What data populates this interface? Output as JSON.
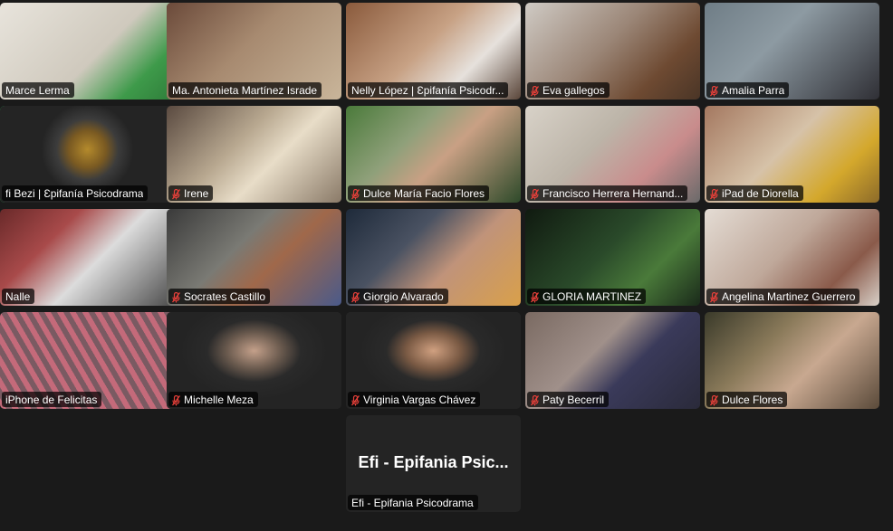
{
  "participants": [
    {
      "name": "Marce Lerma",
      "muted": false,
      "bg": "linear-gradient(135deg,#e8e4dc 0%,#cfc9bd 55%,#3e9a4a 80%,#2f7d3a 100%)"
    },
    {
      "name": "Ma. Antonieta Martínez Israde",
      "muted": false,
      "bg": "linear-gradient(135deg,#6b4a3a 0%,#a78a70 45%,#c9b59a 100%)"
    },
    {
      "name": "Nelly López | Ɛpifanía Psicodr...",
      "muted": false,
      "bg": "linear-gradient(135deg,#8a5a3c 0%,#c7a184 45%,#e6e1dc 70%,#5a463a 100%)"
    },
    {
      "name": "Eva gallegos",
      "muted": true,
      "bg": "linear-gradient(135deg,#cfcac4 0%,#9b8677 45%,#6e4a32 75%,#4a3526 100%)"
    },
    {
      "name": "Amalia Parra",
      "muted": true,
      "bg": "linear-gradient(135deg,#6f7d86 0%,#8d9aa2 40%,#2f2f35 100%)"
    },
    {
      "name": "fi Bezi | Ɛpifanía Psicodrama",
      "muted": false,
      "bg": "radial-gradient(circle at 50% 45%,#b48a2c 0%,#7a5a22 18%,#3c3c3c 30%,#242424 45%)"
    },
    {
      "name": "Irene",
      "muted": true,
      "bg": "linear-gradient(135deg,#5a4a40 0%,#b8a890 40%,#e8ddc8 60%,#8a7a68 100%)"
    },
    {
      "name": "Dulce María Facio Flores",
      "muted": true,
      "bg": "linear-gradient(135deg,#4a7a3a 0%,#8fa07a 35%,#c9a084 55%,#2e4a2a 100%)"
    },
    {
      "name": "Francisco Herrera Hernand...",
      "muted": true,
      "bg": "linear-gradient(135deg,#d8d2c8 0%,#bcb4a8 40%,#c98c8c 70%,#6a6a6a 100%)"
    },
    {
      "name": "iPad de Diorella",
      "muted": true,
      "bg": "linear-gradient(135deg,#a47860 0%,#d6c2a8 45%,#d4a82c 75%,#8c6a2a 100%)"
    },
    {
      "name": "Nalle",
      "muted": false,
      "bg": "linear-gradient(135deg,#6a2a2a 0%,#a84a4a 30%,#dcdcdc 55%,#4a4a4a 100%)"
    },
    {
      "name": "Socrates Castillo",
      "muted": true,
      "bg": "linear-gradient(135deg,#3a3a3a 0%,#7a7a74 40%,#a0684a 60%,#4a5a8a 100%)"
    },
    {
      "name": "Giorgio Alvarado",
      "muted": true,
      "bg": "linear-gradient(135deg,#1e2a3a 0%,#4a5262 35%,#c0937a 60%,#d9a04a 100%)"
    },
    {
      "name": "GLORIA MARTINEZ",
      "muted": true,
      "bg": "linear-gradient(135deg,#101a10 0%,#2a4a2a 45%,#4a7a3a 70%,#1a2a1a 100%)"
    },
    {
      "name": "Angelina Martinez Guerrero",
      "muted": true,
      "bg": "linear-gradient(135deg,#e4dcd4 0%,#bfa89a 45%,#8a5a4a 75%,#d8d0c8 100%)"
    },
    {
      "name": "iPhone de Felicitas",
      "muted": false,
      "bg": "repeating-linear-gradient(60deg,#c46a7a 0px,#c46a7a 6px,#7a5a62 6px,#7a5a62 12px)"
    },
    {
      "name": "Michelle Meza",
      "muted": true,
      "bg": "radial-gradient(ellipse at 50% 40%,#c4a08a 0%,#6a5a4e 22%,#2a2a2a 38%,#242424 60%)"
    },
    {
      "name": "Virginia Vargas Chávez",
      "muted": true,
      "bg": "radial-gradient(ellipse at 50% 40%,#d0a080 0%,#7a5a44 22%,#2a2a2a 38%,#242424 60%)"
    },
    {
      "name": "Paty Becerril",
      "muted": true,
      "bg": "linear-gradient(135deg,#7a6a62 0%,#a0908a 40%,#3a3a5a 60%,#2a2a3a 100%)"
    },
    {
      "name": "Dulce Flores",
      "muted": true,
      "bg": "linear-gradient(135deg,#3a3a2a 0%,#8a7a5a 35%,#c8a890 60%,#5a4a3a 100%)"
    }
  ],
  "host": {
    "display_name": "Efi - Epifania Psic...",
    "name": "Efi - Epifania Psicodrama",
    "muted": false
  },
  "colors": {
    "mute_icon": "#e8403a",
    "active_speaker": "#23d959",
    "tile_bg": "#242424"
  }
}
